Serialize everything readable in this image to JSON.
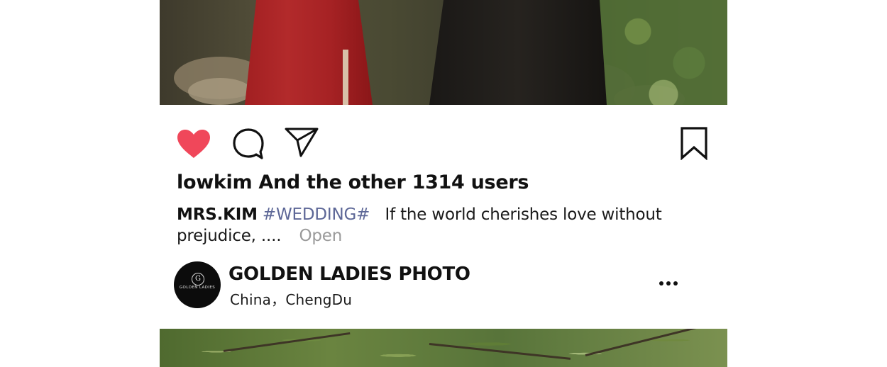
{
  "post": {
    "likes_text": "lowkim And the other 1314 users",
    "caption": {
      "author": "MRS.KIM",
      "hashtag": "#WEDDING#",
      "text": "If the world cherishes love without prejudice, ....",
      "more_label": "Open"
    }
  },
  "actions": {
    "like": {
      "icon": "heart-icon",
      "state": "liked",
      "color": "#f0475a"
    },
    "comment": {
      "icon": "comment-bubble-icon"
    },
    "share": {
      "icon": "send-icon"
    },
    "save": {
      "icon": "bookmark-icon"
    }
  },
  "account": {
    "name": "GOLDEN LADIES PHOTO",
    "location": "China，ChengDu",
    "avatar_logo_text": "GOLDEN LADIES",
    "more_icon": "more-horizontal-icon"
  },
  "colors": {
    "like_red": "#f0475a",
    "hashtag_blue": "#5d6797",
    "muted_gray": "#9a9a9a",
    "text_black": "#111111"
  }
}
